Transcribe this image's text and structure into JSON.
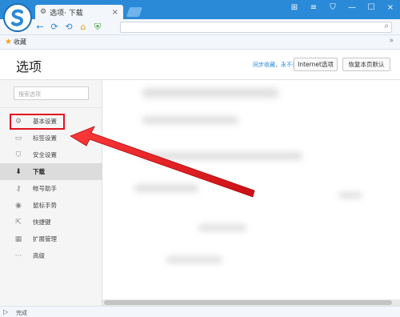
{
  "window": {
    "tab_title": "选项· 下载",
    "tab_close": "×",
    "controls": [
      "⊞",
      "≡",
      "⛉",
      "—",
      "☐",
      "×"
    ]
  },
  "nav": {
    "back": "←",
    "refresh": "⟳",
    "undo": "⟲",
    "home": "⌂",
    "shield": "⛨",
    "search_icon": "⌕"
  },
  "bookmarks": {
    "favorites_label": "收藏",
    "chevron": "»"
  },
  "page": {
    "title": "选项",
    "sync_link": "同步收藏，永不丢失",
    "internet_options_button": "Internet选项",
    "reset_button": "恢复本页默认"
  },
  "sidebar": {
    "search_placeholder": "搜索选项",
    "items": [
      {
        "label": "基本设置",
        "icon": "⚙"
      },
      {
        "label": "标签设置",
        "icon": "▭"
      },
      {
        "label": "安全设置",
        "icon": "⛉"
      },
      {
        "label": "下载",
        "icon": "⬇"
      },
      {
        "label": "帐号助手",
        "icon": "⚷"
      },
      {
        "label": "鼠标手势",
        "icon": "◉"
      },
      {
        "label": "快捷键",
        "icon": "⇱"
      },
      {
        "label": "扩展管理",
        "icon": "▦"
      },
      {
        "label": "高级",
        "icon": "···"
      }
    ],
    "active_index": 3,
    "highlighted_index": 0
  },
  "status": {
    "icon": "▷",
    "text": "完成"
  },
  "colors": {
    "titlebar": "#2a8ad8",
    "highlight": "#e0141e",
    "link": "#2a8ad8"
  }
}
